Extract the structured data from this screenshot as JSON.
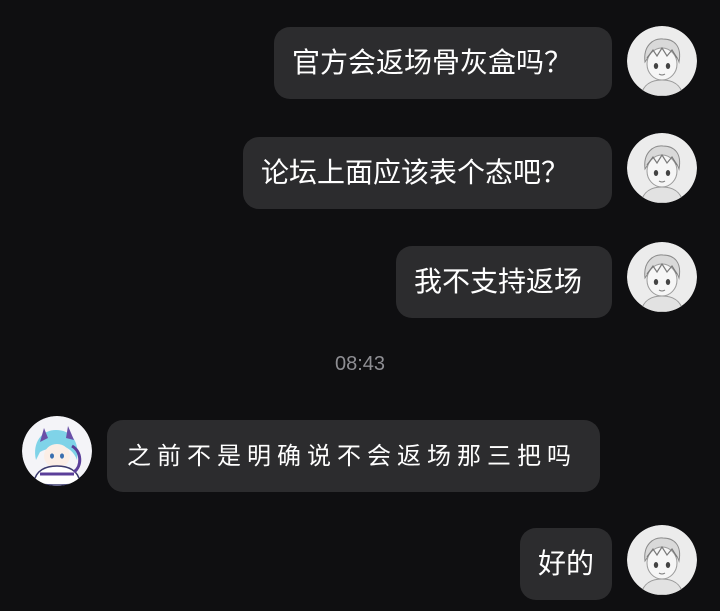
{
  "messages": [
    {
      "sender": "me",
      "text": "官方会返场骨灰盒吗？"
    },
    {
      "sender": "me",
      "text": "论坛上面应该表个态吧？"
    },
    {
      "sender": "me",
      "text": "我不支持返场"
    },
    {
      "sender": "other",
      "text": "之前不是明确说不会返场那三把吗"
    },
    {
      "sender": "me",
      "text": "好的"
    }
  ],
  "timestamp": "08:43",
  "avatars": {
    "me": "sketch-boy-avatar",
    "other": "anime-girl-avatar"
  },
  "colors": {
    "background": "#0f0f11",
    "bubble": "#2c2c2e",
    "text": "#ffffff",
    "timestamp": "#8e8e93"
  }
}
